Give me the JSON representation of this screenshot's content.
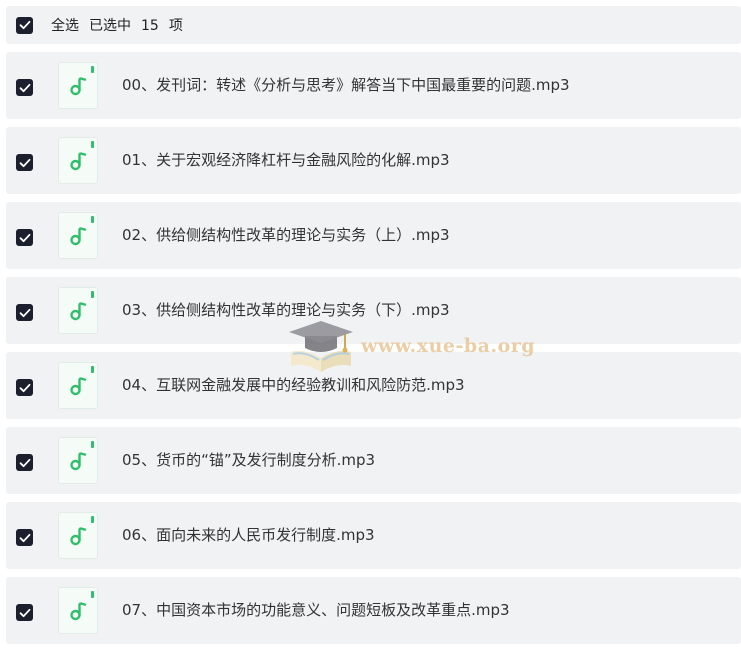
{
  "header": {
    "select_all_label": "全选",
    "selected_label": "已选中",
    "selected_count": "15",
    "unit_label": "项"
  },
  "files": [
    {
      "name": "00、发刊词：转述《分析与思考》解答当下中国最重要的问题.mp3"
    },
    {
      "name": "01、关于宏观经济降杠杆与金融风险的化解.mp3"
    },
    {
      "name": "02、供给侧结构性改革的理论与实务（上）.mp3"
    },
    {
      "name": "03、供给侧结构性改革的理论与实务（下）.mp3"
    },
    {
      "name": "04、互联网金融发展中的经验教训和风险防范.mp3"
    },
    {
      "name": "05、货币的“锚”及发行制度分析.mp3"
    },
    {
      "name": "06、面向未来的人民币发行制度.mp3"
    },
    {
      "name": "07、中国资本市场的功能意义、问题短板及改革重点.mp3"
    }
  ],
  "icons": {
    "checkbox": "checkbox-checked-icon",
    "file": "music-note-icon",
    "watermark": "graduation-cap-icon"
  },
  "colors": {
    "checkbox_fill": "#1c1f2e",
    "row_background": "#f1f2f4",
    "music_accent": "#2fbf6b",
    "watermark_text": "#e8c496"
  },
  "watermark": {
    "text": "www.xue-ba.org"
  }
}
